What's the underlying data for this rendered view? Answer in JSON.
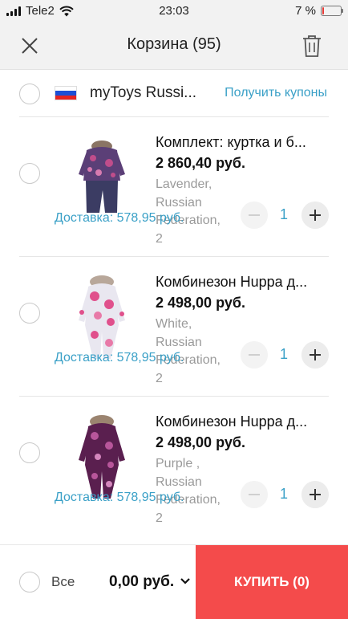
{
  "status_bar": {
    "carrier": "Tele2",
    "time": "23:03",
    "battery": "7 %",
    "battery_level": 0.07
  },
  "header": {
    "title": "Корзина (95)",
    "close_icon": "close-icon",
    "trash_icon": "trash-icon"
  },
  "shop": {
    "name": "myToys Russi...",
    "coupons_label": "Получить купоны",
    "flag": "russia-flag-icon"
  },
  "items": [
    {
      "name": "Комплект: куртка и б...",
      "price": "2 860,40 руб.",
      "attr1": "Lavender,",
      "attr2": "Russian",
      "attr3": "Federation,",
      "attr4": "2",
      "delivery": "Доставка: 578,95 руб.",
      "qty": "1",
      "colors": {
        "primary": "#5b3f77",
        "secondary": "#c04d8b",
        "pants": "#3b3c63"
      }
    },
    {
      "name": "Комбинезон Huppa д...",
      "price": "2 498,00 руб.",
      "attr1": "White,",
      "attr2": "Russian",
      "attr3": "Federation,",
      "attr4": "2",
      "delivery": "Доставка: 578,95 руб.",
      "qty": "1",
      "colors": {
        "primary": "#e9e7f0",
        "secondary": "#e0508c",
        "pants": "#e9e7f0"
      }
    },
    {
      "name": "Комбинезон Huppa д...",
      "price": "2 498,00 руб.",
      "attr1": "Purple    ,",
      "attr2": "Russian",
      "attr3": "Federation,",
      "attr4": "2",
      "delivery": "Доставка: 578,95 руб.",
      "qty": "1",
      "colors": {
        "primary": "#5a1f4f",
        "secondary": "#b8569b",
        "pants": "#5a1f4f"
      }
    }
  ],
  "footer": {
    "select_all_label": "Все",
    "total": "0,00 руб.",
    "buy_label": "КУПИТЬ (0)"
  },
  "colors": {
    "accent": "#3aa0c7",
    "buy": "#f44b4b"
  }
}
